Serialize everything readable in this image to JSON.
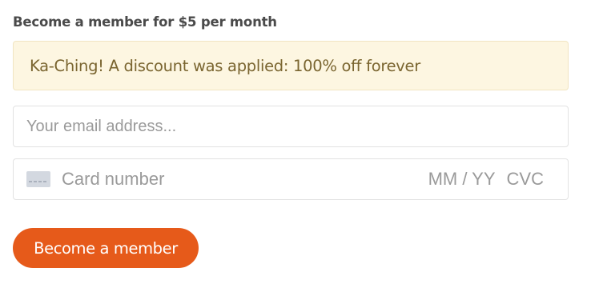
{
  "form": {
    "heading": "Become a member for $5 per month",
    "discount_message": "Ka-Ching! A discount was applied: 100% off forever",
    "email": {
      "placeholder": "Your email address...",
      "value": ""
    },
    "card": {
      "icon": "credit-card-icon",
      "number_placeholder": "Card number",
      "expiry_placeholder": "MM / YY",
      "cvc_placeholder": "CVC"
    },
    "submit_label": "Become a member"
  },
  "colors": {
    "accent": "#e65a1a",
    "discount_background": "#fdf6e1",
    "discount_text": "#7a6530",
    "placeholder": "#9a9a9a"
  }
}
